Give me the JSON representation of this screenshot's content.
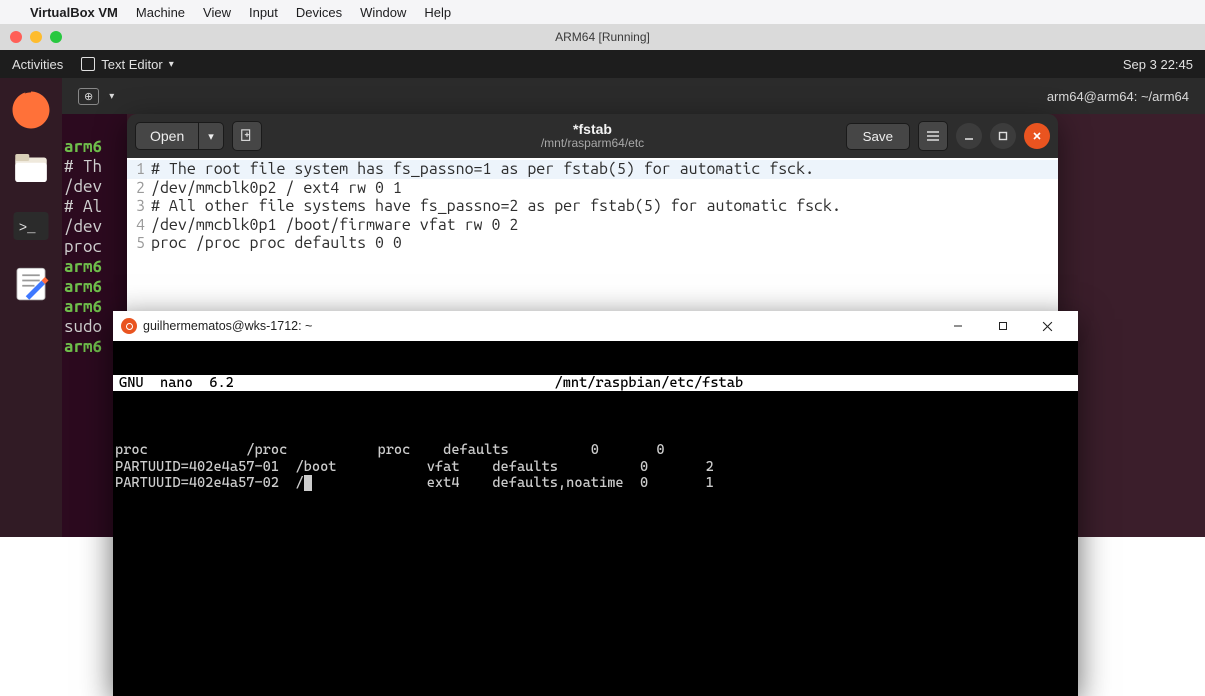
{
  "mac_menu": {
    "app": "VirtualBox VM",
    "items": [
      "Machine",
      "View",
      "Input",
      "Devices",
      "Window",
      "Help"
    ]
  },
  "vm_titlebar": {
    "title": "ARM64 [Running]"
  },
  "ubuntu_topbar": {
    "activities": "Activities",
    "current_app": "Text Editor",
    "clock": "Sep 3  22:45"
  },
  "bg_terminal": {
    "title_right": "arm64@arm64: ~/arm64",
    "strip_lines": [
      {
        "prompt": "arm6",
        "rest": ""
      },
      {
        "prompt": "",
        "rest": "# Th"
      },
      {
        "prompt": "",
        "rest": "/dev"
      },
      {
        "prompt": "",
        "rest": "# Al"
      },
      {
        "prompt": "",
        "rest": "/dev"
      },
      {
        "prompt": "",
        "rest": "proc"
      },
      {
        "prompt": "arm6",
        "rest": ""
      },
      {
        "prompt": "arm6",
        "rest": ""
      },
      {
        "prompt": "arm6",
        "rest": ""
      },
      {
        "prompt": "",
        "rest": "sudo"
      },
      {
        "prompt": "arm6",
        "rest": ""
      }
    ]
  },
  "gedit": {
    "open_label": "Open",
    "save_label": "Save",
    "title": "*fstab",
    "subtitle": "/mnt/rasparm64/etc",
    "lines": [
      "# The root file system has fs_passno=1 as per fstab(5) for automatic fsck.",
      "/dev/mmcblk0p2 / ext4 rw 0 1",
      "# All other file systems have fs_passno=2 as per fstab(5) for automatic fsck.",
      "/dev/mmcblk0p1 /boot/firmware vfat rw 0 2",
      "proc /proc proc defaults 0 0"
    ]
  },
  "winterm": {
    "title": "guilhermematos@wks-1712: ~",
    "nano_version": "GNU  nano  6.2",
    "nano_file": "/mnt/raspbian/etc/fstab",
    "rows": [
      "proc            /proc           proc    defaults          0       0",
      "PARTUUID=402e4a57-01  /boot           vfat    defaults          0       2",
      "PARTUUID=402e4a57-02  /               ext4    defaults,noatime  0       1"
    ]
  }
}
